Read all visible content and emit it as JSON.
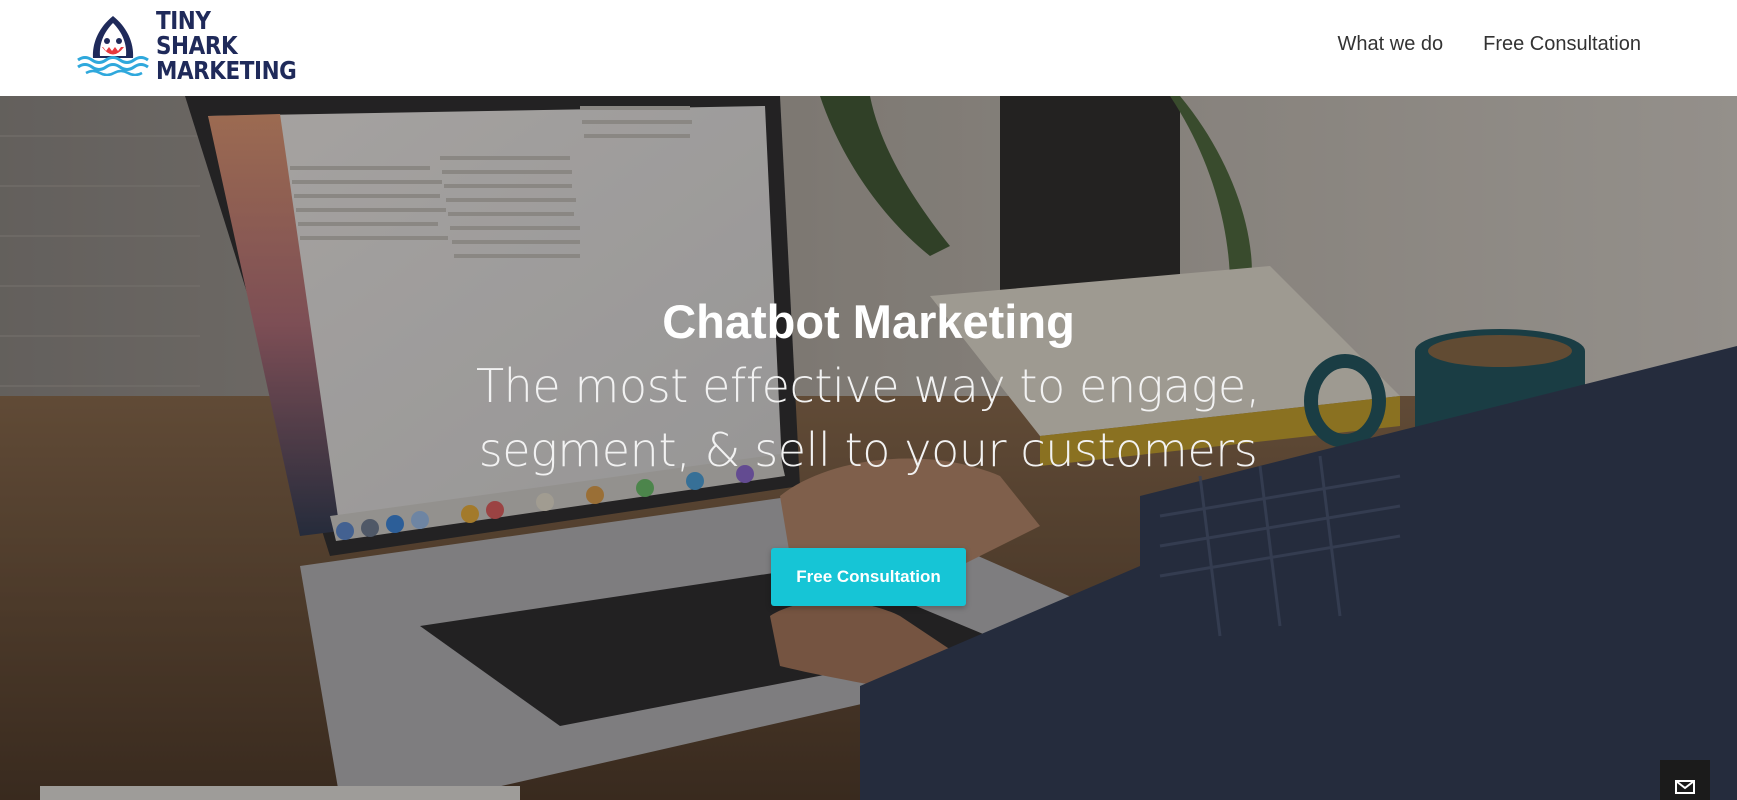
{
  "brand": {
    "name_line1": "TINY SHARK",
    "name_line2": "MARKETING",
    "color": "#1f2a5a",
    "logo_icon": "shark-logo-icon"
  },
  "nav": {
    "items": [
      {
        "label": "What we do"
      },
      {
        "label": "Free Consultation"
      }
    ]
  },
  "hero": {
    "title": "Chatbot Marketing",
    "subtitle": "The most effective way to engage, segment, & sell to your customers",
    "cta_label": "Free Consultation",
    "cta_color": "#16c5d6",
    "background_image": "laptop-desk-photo"
  },
  "widgets": {
    "mail_icon": "mail-icon"
  }
}
